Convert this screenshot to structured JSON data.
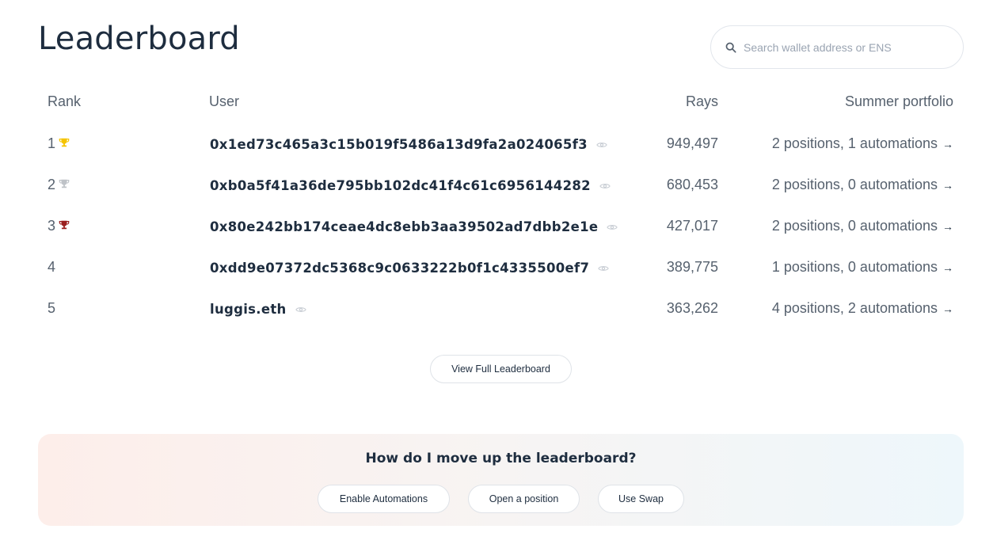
{
  "page_title": "Leaderboard",
  "search": {
    "placeholder": "Search wallet address or ENS",
    "value": ""
  },
  "columns": {
    "rank": "Rank",
    "user": "User",
    "rays": "Rays",
    "portfolio": "Summer portfolio"
  },
  "rows": [
    {
      "rank": "1",
      "trophy": "gold",
      "user": "0x1ed73c465a3c15b019f5486a13d9fa2a024065f3",
      "rays": "949,497",
      "portfolio": "2 positions, 1 automations"
    },
    {
      "rank": "2",
      "trophy": "silver",
      "user": "0xb0a5f41a36de795bb102dc41f4c61c6956144282",
      "rays": "680,453",
      "portfolio": "2 positions, 0 automations"
    },
    {
      "rank": "3",
      "trophy": "bronze",
      "user": "0x80e242bb174ceae4dc8ebb3aa39502ad7dbb2e1e",
      "rays": "427,017",
      "portfolio": "2 positions, 0 automations"
    },
    {
      "rank": "4",
      "trophy": "",
      "user": "0xdd9e07372dc5368c9c0633222b0f1c4335500ef7",
      "rays": "389,775",
      "portfolio": "1 positions, 0 automations"
    },
    {
      "rank": "5",
      "trophy": "",
      "user": "luggis.eth",
      "rays": "363,262",
      "portfolio": "4 positions, 2 automations"
    }
  ],
  "arrow": "→",
  "view_full_label": "View Full Leaderboard",
  "cta": {
    "title": "How do I move up the leaderboard?",
    "buttons": [
      "Enable Automations",
      "Open a position",
      "Use Swap"
    ]
  },
  "colors": {
    "gold": "#f5c400",
    "silver": "#bfc3c8",
    "bronze": "#9b1f1f",
    "text": "#1e2d3f",
    "muted": "#56616e"
  }
}
